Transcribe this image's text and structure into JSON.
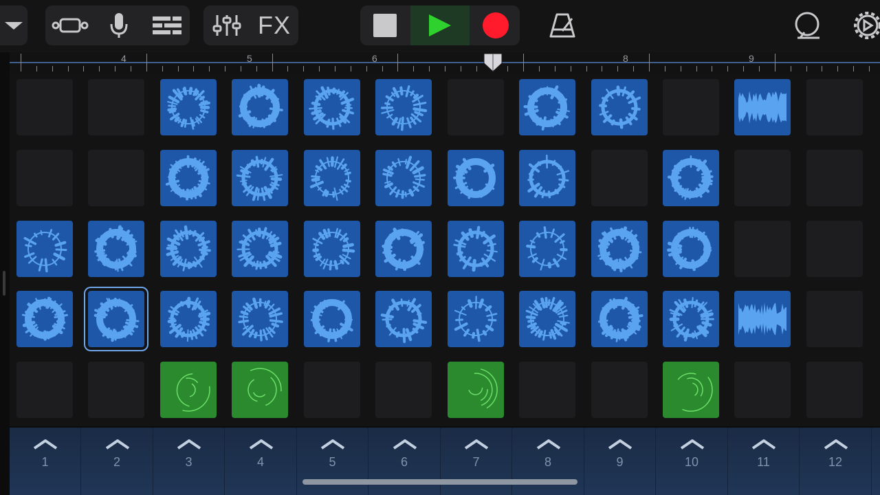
{
  "toolbar": {
    "fx_label": "FX",
    "icons": [
      "browser-dropdown-icon",
      "tracks-view-icon",
      "microphone-icon",
      "live-loops-grid-icon",
      "mixer-icon",
      "fx-button",
      "stop-icon",
      "play-icon",
      "record-icon",
      "metronome-icon",
      "loop-browser-icon",
      "settings-icon"
    ],
    "colors": {
      "play": "#2fd12f",
      "record": "#ff1a2c",
      "active_bg": "#1f3a24"
    }
  },
  "ruler": {
    "bar_labels": [
      "4",
      "5",
      "6",
      "8",
      "9"
    ]
  },
  "grid": {
    "rows": [
      [
        "empty",
        "empty",
        "blue",
        "blue",
        "blue",
        "blue",
        "empty",
        "blue",
        "blue",
        "empty",
        "blue",
        "empty"
      ],
      [
        "empty",
        "empty",
        "blue",
        "blue",
        "blue",
        "blue",
        "blue",
        "blue",
        "empty",
        "blue",
        "empty",
        "empty"
      ],
      [
        "blue",
        "blue",
        "blue",
        "blue",
        "blue",
        "blue",
        "blue",
        "blue",
        "blue",
        "blue",
        "empty",
        "empty"
      ],
      [
        "blue",
        "blue",
        "blue",
        "blue",
        "blue",
        "blue",
        "blue",
        "blue",
        "blue",
        "blue",
        "blue",
        "empty"
      ],
      [
        "empty",
        "empty",
        "green",
        "green",
        "empty",
        "empty",
        "green",
        "empty",
        "empty",
        "green",
        "empty",
        "empty"
      ]
    ],
    "selected_cell": {
      "row": 3,
      "col": 1
    },
    "colors": {
      "blue": "#1f57a8",
      "green": "#2a8a2d",
      "wave_blue": "#5aa3f0",
      "wave_green": "#6de06a"
    }
  },
  "triggers": [
    "1",
    "2",
    "3",
    "4",
    "5",
    "6",
    "7",
    "8",
    "9",
    "10",
    "11",
    "12"
  ]
}
